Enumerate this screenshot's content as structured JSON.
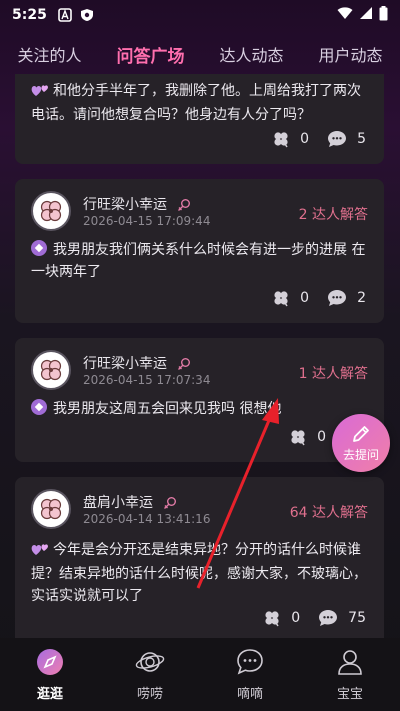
{
  "status_bar": {
    "time": "5:25"
  },
  "tabs": [
    {
      "label": "关注的人"
    },
    {
      "label": "问答广场",
      "active": true
    },
    {
      "label": "达人动态"
    },
    {
      "label": "用户动态"
    }
  ],
  "posts": [
    {
      "user": "",
      "time": "",
      "answers": "",
      "text": "和他分手半年了，我删除了他。上周给我打了两次电话。请问他想复合吗？他身边有人分了吗？",
      "likes": "0",
      "comments": "5"
    },
    {
      "user": "行旺梁小幸运",
      "time": "2026-04-15 17:09:44",
      "answers": "2 达人解答",
      "text": "我男朋友我们俩关系什么时候会有进一步的进展 在一块两年了",
      "likes": "0",
      "comments": "2"
    },
    {
      "user": "行旺梁小幸运",
      "time": "2026-04-15 17:07:34",
      "answers": "1 达人解答",
      "text": "我男朋友这周五会回来见我吗 很想他",
      "likes": "0",
      "comments": ""
    },
    {
      "user": "盘肩小幸运",
      "time": "2026-04-14 13:41:16",
      "answers": "64 达人解答",
      "text": "今年是会分开还是结束异地？分开的话什么时候谁提？结束异地的话什么时候呢，感谢大家，不玻璃心，实话实说就可以了",
      "likes": "0",
      "comments": "75"
    }
  ],
  "fab": {
    "label": "去提问"
  },
  "bottom_nav": [
    {
      "label": "逛逛",
      "active": true
    },
    {
      "label": "唠唠"
    },
    {
      "label": "嘀嘀"
    },
    {
      "label": "宝宝"
    }
  ],
  "colors": {
    "accent": "#ff6fae",
    "answers": "#e0708e",
    "card_bg": "#262228",
    "annotation_arrow": "#e8212b"
  }
}
